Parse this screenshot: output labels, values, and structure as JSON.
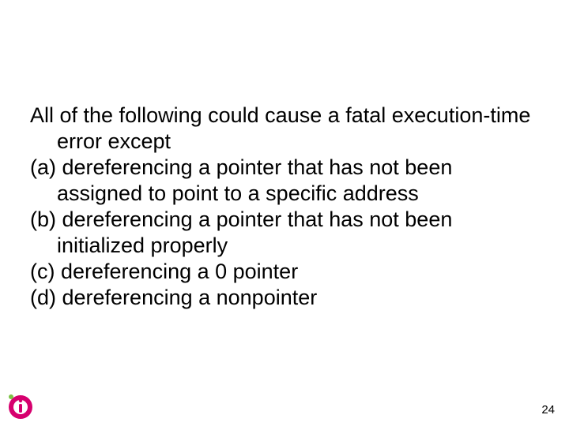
{
  "question": {
    "stem": "All of the following could cause a fatal execution-time error except",
    "options": {
      "a": "(a) dereferencing a pointer that has not been assigned to point to a specific address",
      "b": "(b) dereferencing a pointer that has not been initialized properly",
      "c": "(c) dereferencing a 0 pointer",
      "d": "(d) dereferencing a nonpointer"
    }
  },
  "page_number": "24"
}
